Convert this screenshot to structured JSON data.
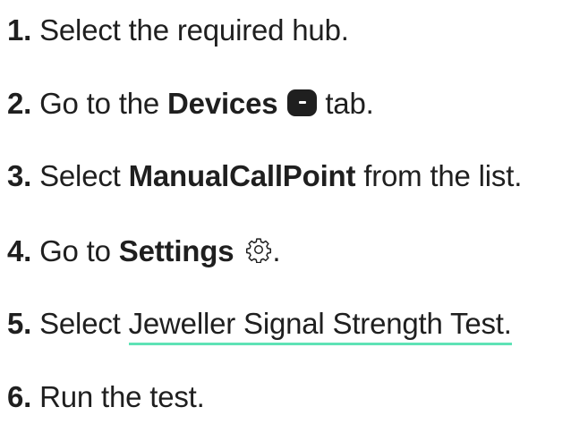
{
  "steps": [
    {
      "number": "1.",
      "text": "Select the required hub."
    },
    {
      "number": "2.",
      "before": "Go to the",
      "bold": "Devices",
      "icon": "devices-icon",
      "after": "tab."
    },
    {
      "number": "3.",
      "before": "Select",
      "bold": "ManualCallPoint",
      "after": "from the list."
    },
    {
      "number": "4.",
      "before": "Go to",
      "bold": "Settings",
      "icon": "gear-icon",
      "after": "."
    },
    {
      "number": "5.",
      "before": "Select",
      "link": "Jeweller Signal Strength Test.",
      "link_color": "#5fe3b6"
    },
    {
      "number": "6.",
      "text": "Run the test."
    }
  ]
}
